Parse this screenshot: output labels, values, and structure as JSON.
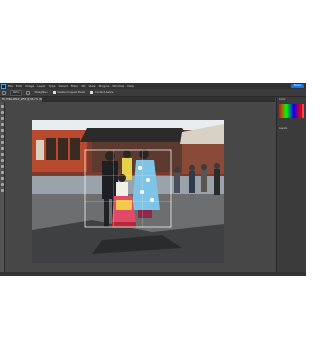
{
  "menubar": {
    "items": [
      "File",
      "Edit",
      "Image",
      "Layer",
      "Type",
      "Select",
      "Filter",
      "3D",
      "View",
      "Plugins",
      "Window",
      "Help"
    ],
    "share_label": "Share"
  },
  "options": {
    "ratio_label": "Ratio",
    "straighten_label": "Straighten",
    "delete_cropped_label": "Delete Cropped Pixels",
    "content_aware_label": "Content-Aware"
  },
  "document": {
    "tab_title": "PC-HIRA-PPA-T_ZF.8 @ 66.7% (RGB/8)"
  },
  "panels": {
    "color_title": "Color",
    "layers_title": "Layers"
  },
  "colors": {
    "accent": "#1473e6",
    "app_bg": "#474747",
    "panel_bg": "#3b3b3b"
  }
}
